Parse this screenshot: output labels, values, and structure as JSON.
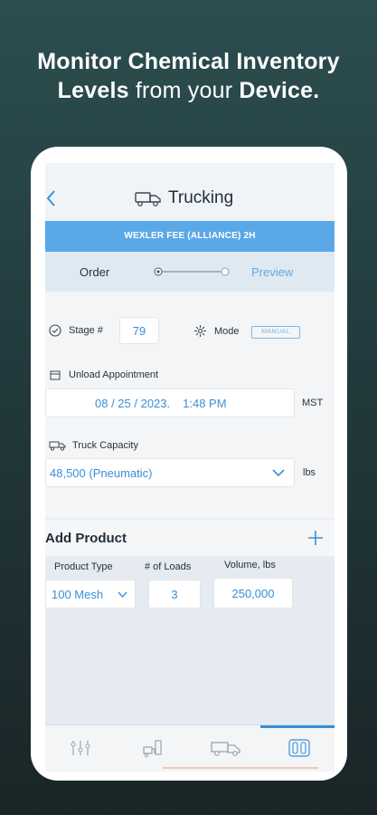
{
  "headline": {
    "line1": "Monitor Chemical Inventory",
    "line2_bold1": "Levels",
    "line2_mid": " from your ",
    "line2_bold2": "Device."
  },
  "header": {
    "title": "Trucking"
  },
  "banner": {
    "text": "WEXLER FEE (ALLIANCE) 2H"
  },
  "steps": {
    "order": "Order",
    "preview": "Preview"
  },
  "form": {
    "stage_label": "Stage #",
    "stage_value": "79",
    "mode_label": "Mode",
    "mode_value": "MANUAL",
    "unload_label": "Unload Appointment",
    "unload_date": "08 / 25 / 2023.",
    "unload_time": "1:48 PM",
    "unload_tz": "MST",
    "capacity_label": "Truck Capacity",
    "capacity_value": "48,500 (Pneumatic)",
    "capacity_unit": "lbs"
  },
  "add_product": {
    "title": "Add Product"
  },
  "products": {
    "columns": [
      "Product Type",
      "# of Loads",
      "Volume, lbs"
    ],
    "row": {
      "type": "100 Mesh",
      "loads": "3",
      "volume": "250,000"
    }
  },
  "nav": {
    "items": [
      {
        "icon": "wellsite-icon"
      },
      {
        "icon": "silo-truck-icon"
      },
      {
        "icon": "trucking-icon"
      },
      {
        "icon": "inventory-icon"
      }
    ],
    "active_index": 3,
    "accent": "#3a8fd6"
  },
  "colors": {
    "banner": "#5ba8e6",
    "accent": "#3a8fd6",
    "background": "#2c4e50"
  }
}
